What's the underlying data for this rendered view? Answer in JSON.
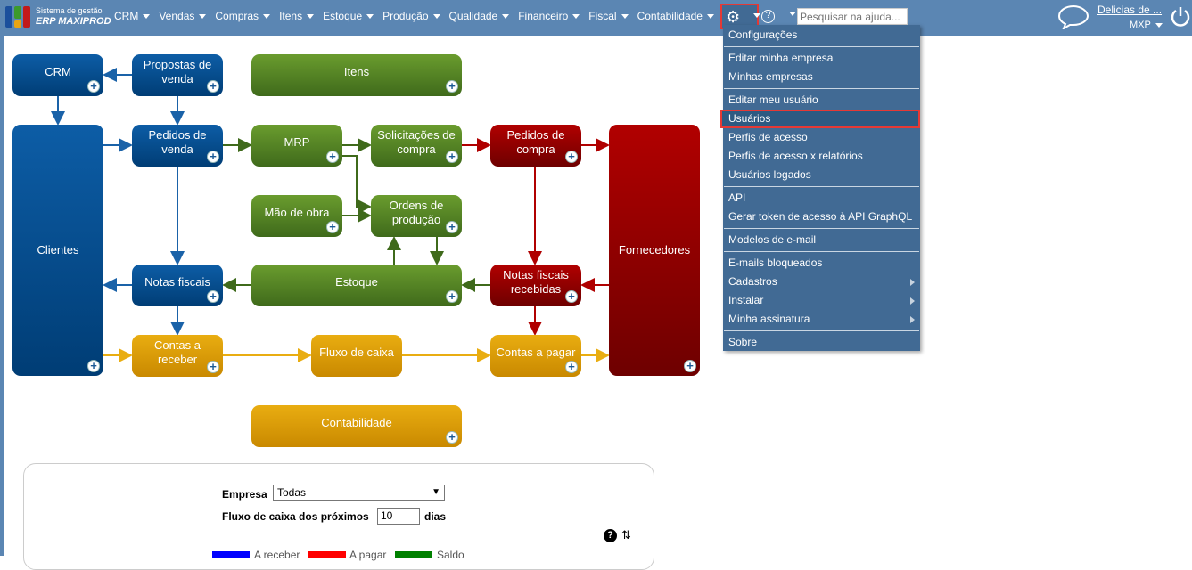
{
  "header": {
    "brand_line1": "Sistema de gestão",
    "brand_line2": "ERP MAXIPROD",
    "nav": [
      "CRM",
      "Vendas",
      "Compras",
      "Itens",
      "Estoque",
      "Produção",
      "Qualidade",
      "Financeiro",
      "Fiscal",
      "Contabilidade"
    ],
    "search_placeholder": "Pesquisar na ajuda...",
    "user": "Delicias de ...",
    "company": "MXP"
  },
  "settings_menu": {
    "groups": [
      [
        "Configurações"
      ],
      [
        "Editar minha empresa",
        "Minhas empresas"
      ],
      [
        "Editar meu usuário",
        "Usuários",
        "Perfis de acesso",
        "Perfis de acesso x relatórios",
        "Usuários logados"
      ],
      [
        "API",
        "Gerar token de acesso à API GraphQL"
      ],
      [
        "Modelos de e-mail"
      ],
      [
        "E-mails bloqueados",
        "Cadastros",
        "Instalar",
        "Minha assinatura"
      ],
      [
        "Sobre"
      ]
    ],
    "selected": "Usuários",
    "with_submenu": [
      "Cadastros",
      "Instalar",
      "Minha assinatura"
    ]
  },
  "flow": {
    "crm": "CRM",
    "propostas": "Propostas de venda",
    "itens": "Itens",
    "clientes": "Clientes",
    "pedidos_venda": "Pedidos de venda",
    "mrp": "MRP",
    "solicitacoes": "Solicitações de compra",
    "pedidos_compra": "Pedidos de compra",
    "fornecedores": "Fornecedores",
    "mao_obra": "Mão de obra",
    "ordens": "Ordens de produção",
    "notas": "Notas fiscais",
    "estoque": "Estoque",
    "notas_recebidas": "Notas fiscais recebidas",
    "contas_receber": "Contas a receber",
    "fluxo": "Fluxo de caixa",
    "contas_pagar": "Contas a pagar",
    "contabilidade": "Contabilidade"
  },
  "cashflow": {
    "empresa_label": "Empresa",
    "empresa_value": "Todas",
    "fluxo_label": "Fluxo de caixa dos próximos",
    "days_value": "10",
    "days_unit": "dias",
    "legend": [
      {
        "label": "A receber",
        "color": "#0000ff"
      },
      {
        "label": "A pagar",
        "color": "#ff0000"
      },
      {
        "label": "Saldo",
        "color": "#008000"
      }
    ]
  }
}
